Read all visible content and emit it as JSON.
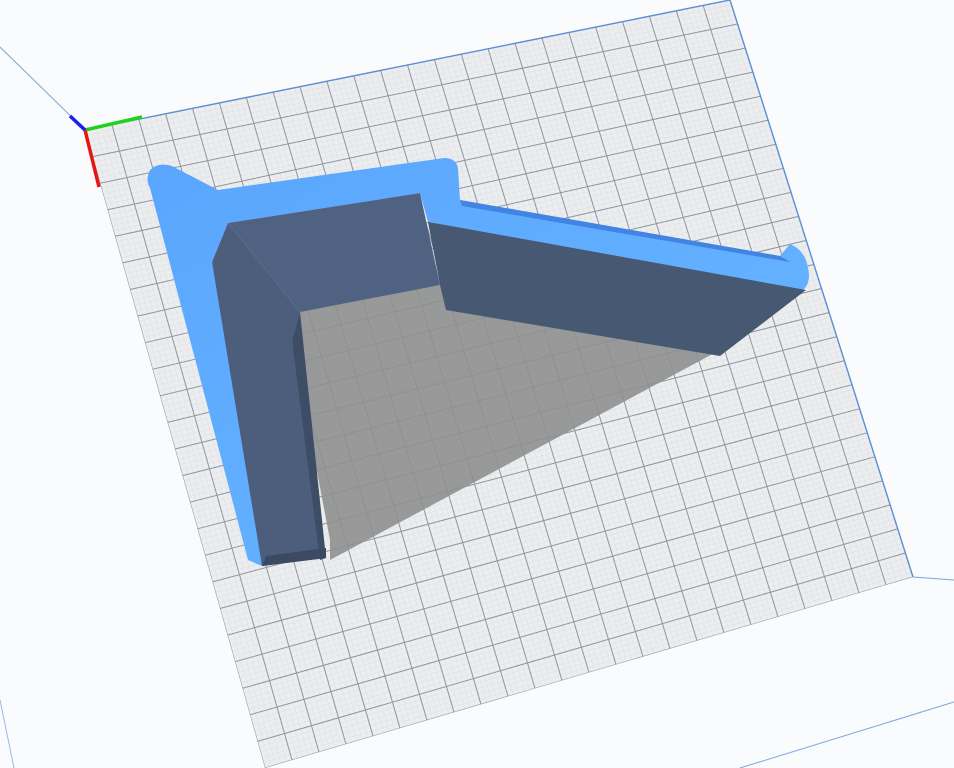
{
  "viewer": {
    "mode": "3d-print-preview",
    "background_color": "#fafbfc",
    "bed_color": "#ebedef",
    "grid_fine_color": "#dcdfe3",
    "grid_major_color": "#8e969f",
    "bed_edge_color": "#5b8fd6",
    "model_top_color": "#5aa9ff",
    "model_side_color": "#4c5e7c",
    "model_side_dark_color": "#475872",
    "shadow_color": "#8f8f8f",
    "axes": {
      "x_color": "#e81515",
      "y_color": "#1ed21e",
      "z_color": "#1d1df0"
    }
  }
}
